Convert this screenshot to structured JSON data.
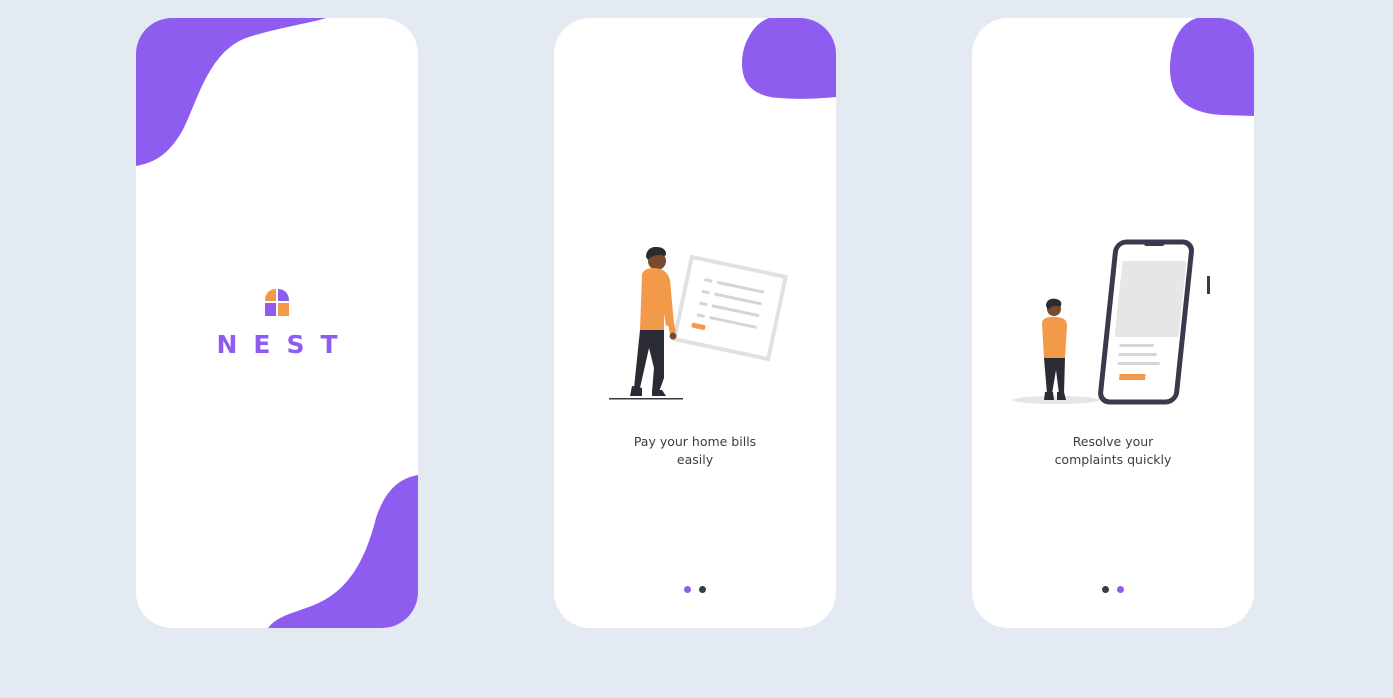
{
  "colors": {
    "background": "#e4eaf1",
    "card": "#ffffff",
    "accent": "#8f5cf0",
    "orange": "#f2994a",
    "dark": "#3a3a42"
  },
  "splash": {
    "brand": "NEST",
    "logo_icon": "house-window-icon"
  },
  "onboarding_1": {
    "caption_line1": "Pay your home bills",
    "caption_line2": "easily",
    "illustration": "person-with-bill-icon",
    "dots": [
      {
        "active": true
      },
      {
        "active": false
      }
    ]
  },
  "onboarding_2": {
    "caption_line1": "Resolve your",
    "caption_line2": "complaints quickly",
    "illustration": "person-with-phone-icon",
    "dots": [
      {
        "active": false
      },
      {
        "active": true
      }
    ]
  }
}
